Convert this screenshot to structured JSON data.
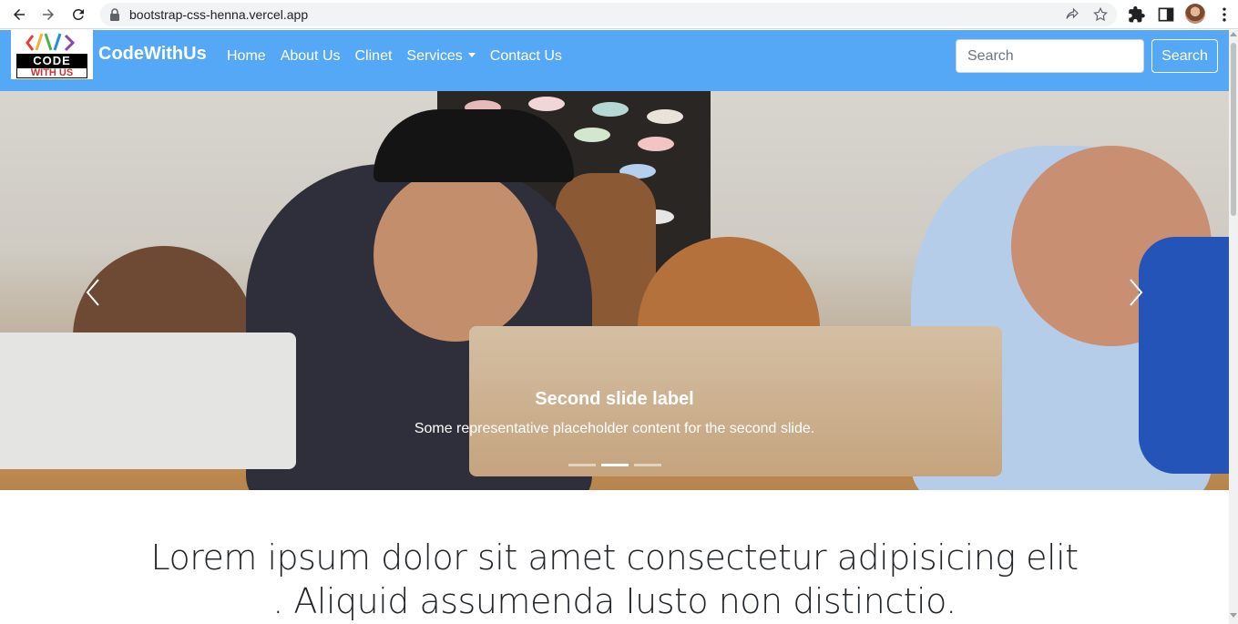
{
  "browser": {
    "url": "bootstrap-css-henna.vercel.app",
    "back_icon": "arrow-left-icon",
    "forward_icon": "arrow-right-icon",
    "reload_icon": "reload-icon"
  },
  "navbar": {
    "logo_top": "CODE",
    "logo_bottom": "WITH US",
    "brand": "CodeWithUs",
    "links": [
      "Home",
      "About Us",
      "Clinet",
      "Services",
      "Contact Us"
    ],
    "search_placeholder": "Search",
    "search_button": "Search",
    "bg_color": "#55a8f5"
  },
  "carousel": {
    "caption_title": "Second slide label",
    "caption_text": "Some representative placeholder content for the second slide.",
    "slide_count": 3,
    "active_slide": 2
  },
  "main": {
    "headline_line1": "Lorem ipsum dolor sit amet consectetur adipisicing elit",
    "headline_line2": ". Aliquid assumenda Iusto non distinctio."
  }
}
